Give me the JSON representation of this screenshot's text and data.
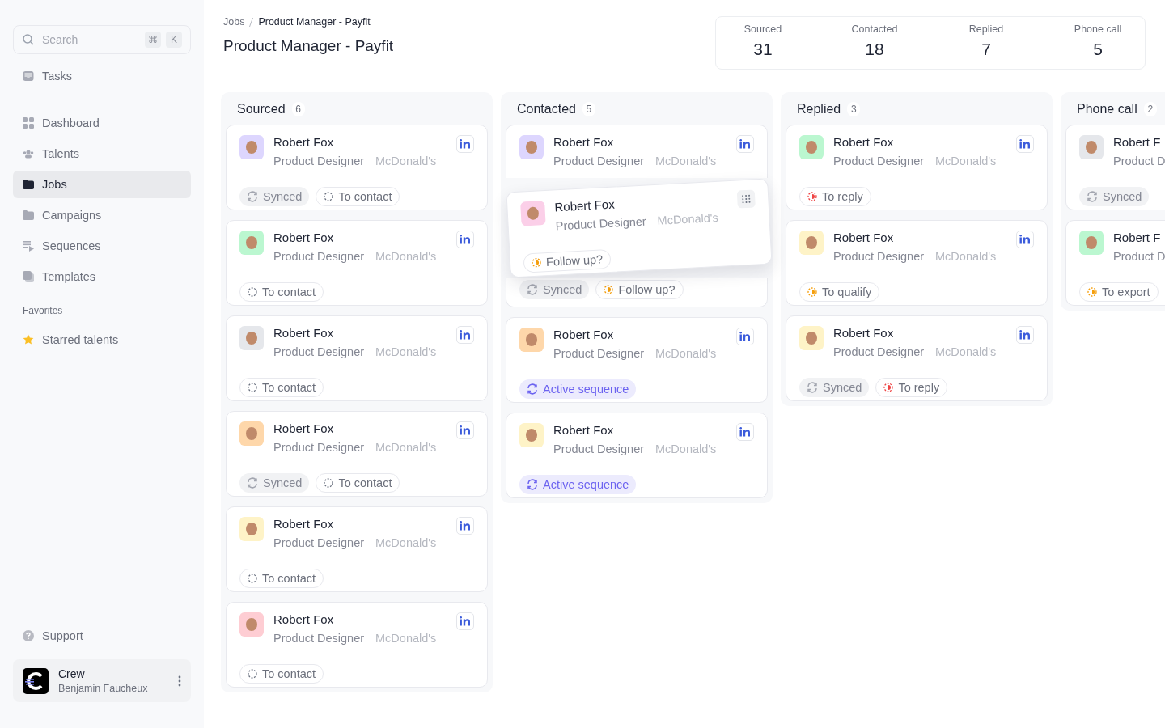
{
  "sidebar": {
    "search": {
      "placeholder": "Search",
      "keys": [
        "⌘",
        "K"
      ]
    },
    "top_items": [
      {
        "label": "Tasks",
        "selected": false
      }
    ],
    "nav_items": [
      {
        "label": "Dashboard",
        "selected": false
      },
      {
        "label": "Talents",
        "selected": false
      },
      {
        "label": "Jobs",
        "selected": true
      },
      {
        "label": "Campaigns",
        "selected": false
      },
      {
        "label": "Sequences",
        "selected": false
      },
      {
        "label": "Templates",
        "selected": false
      }
    ],
    "favorites_title": "Favorites",
    "favorites": [
      {
        "label": "Starred talents",
        "selected": false
      }
    ],
    "support": "Support",
    "workspace": {
      "name": "Crew",
      "user": "Benjamin Faucheux"
    }
  },
  "breadcrumb": [
    "Jobs",
    "Product Manager - Payfit"
  ],
  "title": "Product Manager - Payfit",
  "stats": [
    {
      "label": "Sourced",
      "value": "31"
    },
    {
      "label": "Contacted",
      "value": "18"
    },
    {
      "label": "Replied",
      "value": "7"
    },
    {
      "label": "Phone call",
      "value": "5"
    }
  ],
  "columns": [
    {
      "title": "Sourced",
      "count": "6",
      "cards": [
        {
          "kind": "full",
          "name": "Robert Fox",
          "role": "Product Designer",
          "company": "McDonald's",
          "linkedin": true,
          "color": "#ddd6fe",
          "tags": [
            {
              "kind": "synced",
              "label": "Synced"
            },
            {
              "kind": "contact",
              "label": "To contact"
            }
          ]
        },
        {
          "kind": "full",
          "name": "Robert Fox",
          "role": "Product Designer",
          "company": "McDonald's",
          "linkedin": true,
          "color": "#bbf7d0",
          "tags": [
            {
              "kind": "contact",
              "label": "To contact"
            }
          ]
        },
        {
          "kind": "full",
          "name": "Robert Fox",
          "role": "Product Designer",
          "company": "McDonald's",
          "linkedin": true,
          "color": "#e5e7eb",
          "tags": [
            {
              "kind": "contact",
              "label": "To contact"
            }
          ]
        },
        {
          "kind": "full",
          "name": "Robert Fox",
          "role": "Product Designer",
          "company": "McDonald's",
          "linkedin": true,
          "color": "#fed7aa",
          "tags": [
            {
              "kind": "synced",
              "label": "Synced"
            },
            {
              "kind": "contact",
              "label": "To contact"
            }
          ]
        },
        {
          "kind": "full",
          "name": "Robert Fox",
          "role": "Product Designer",
          "company": "McDonald's",
          "linkedin": true,
          "color": "#fef3c7",
          "tags": [
            {
              "kind": "contact",
              "label": "To contact"
            }
          ]
        },
        {
          "kind": "full",
          "name": "Robert Fox",
          "role": "Product Designer",
          "company": "McDonald's",
          "linkedin": true,
          "color": "#fecdd3",
          "tags": [
            {
              "kind": "contact",
              "label": "To contact"
            }
          ]
        }
      ]
    },
    {
      "title": "Contacted",
      "count": "5",
      "cards": [
        {
          "kind": "top",
          "name": "Robert Fox",
          "role": "Product Designer",
          "company": "McDonald's",
          "linkedin": true,
          "color": "#ddd6fe"
        },
        {
          "kind": "dragged",
          "name": "Robert Fox",
          "role": "Product Designer",
          "company": "McDonald's",
          "color": "#fbcfe8",
          "tags": [
            {
              "kind": "followup",
              "label": "Follow up?"
            }
          ]
        },
        {
          "kind": "bottom",
          "tags": [
            {
              "kind": "synced",
              "label": "Synced"
            },
            {
              "kind": "followup",
              "label": "Follow up?"
            }
          ]
        },
        {
          "kind": "full",
          "name": "Robert Fox",
          "role": "Product Designer",
          "company": "McDonald's",
          "linkedin": true,
          "color": "#fed7aa",
          "tags": [
            {
              "kind": "active",
              "label": "Active sequence"
            }
          ]
        },
        {
          "kind": "full",
          "name": "Robert Fox",
          "role": "Product Designer",
          "company": "McDonald's",
          "linkedin": true,
          "color": "#fef3c7",
          "tags": [
            {
              "kind": "active",
              "label": "Active sequence"
            }
          ]
        }
      ]
    },
    {
      "title": "Replied",
      "count": "3",
      "cards": [
        {
          "kind": "full",
          "name": "Robert Fox",
          "role": "Product Designer",
          "company": "McDonald's",
          "linkedin": true,
          "color": "#bbf7d0",
          "tags": [
            {
              "kind": "reply",
              "label": "To reply"
            }
          ]
        },
        {
          "kind": "full",
          "name": "Robert Fox",
          "role": "Product Designer",
          "company": "McDonald's",
          "linkedin": true,
          "color": "#fef3c7",
          "tags": [
            {
              "kind": "followup",
              "label": "To qualify"
            }
          ]
        },
        {
          "kind": "full",
          "name": "Robert Fox",
          "role": "Product Designer",
          "company": "McDonald's",
          "linkedin": true,
          "color": "#fef3c7",
          "tags": [
            {
              "kind": "synced",
              "label": "Synced"
            },
            {
              "kind": "reply",
              "label": "To reply"
            }
          ]
        }
      ]
    },
    {
      "title": "Phone call",
      "count": "2",
      "cards": [
        {
          "kind": "full",
          "name": "Robert F",
          "role": "Product D",
          "color": "#e5e7eb",
          "tags": [
            {
              "kind": "synced",
              "label": "Synced"
            }
          ]
        },
        {
          "kind": "full",
          "name": "Robert F",
          "role": "Product D",
          "color": "#bbf7d0",
          "tags": [
            {
              "kind": "followup",
              "label": "To export"
            }
          ]
        }
      ]
    }
  ]
}
